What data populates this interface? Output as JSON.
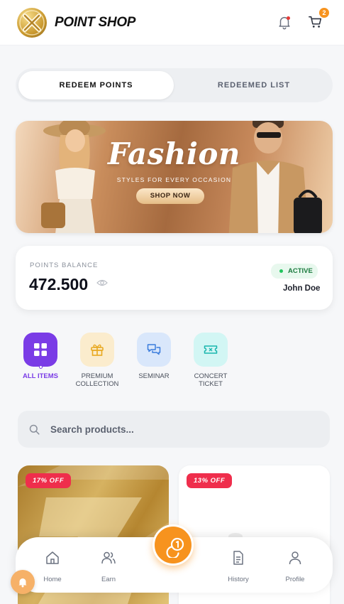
{
  "header": {
    "brand": "POINT SHOP",
    "cart_count": "2"
  },
  "tabs": [
    {
      "label": "REDEEM POINTS",
      "active": true
    },
    {
      "label": "REDEEMED LIST",
      "active": false
    }
  ],
  "banner": {
    "title": "Fashion",
    "subtitle": "STYLES FOR EVERY OCCASION",
    "cta": "SHOP NOW"
  },
  "balance": {
    "label": "POINTS BALANCE",
    "value": "472.500",
    "status": "ACTIVE",
    "user_name": "John Doe"
  },
  "categories": [
    {
      "label": "ALL ITEMS",
      "icon": "grid-icon",
      "active": true
    },
    {
      "label": "PREMIUM COLLECTION",
      "icon": "gift-icon",
      "active": false
    },
    {
      "label": "SEMINAR",
      "icon": "chat-icon",
      "active": false
    },
    {
      "label": "CONCERT TICKET",
      "icon": "ticket-icon",
      "active": false
    }
  ],
  "search": {
    "placeholder": "Search products..."
  },
  "products": [
    {
      "discount": "17% OFF"
    },
    {
      "discount": "13% OFF"
    }
  ],
  "bottom_nav": [
    {
      "label": "Home",
      "icon": "home-icon"
    },
    {
      "label": "Earn",
      "icon": "users-icon"
    },
    {
      "label": "History",
      "icon": "document-icon"
    },
    {
      "label": "Profile",
      "icon": "user-icon"
    }
  ],
  "colors": {
    "accent_purple": "#7a3ce6",
    "accent_orange": "#f7931e",
    "discount_red": "#ef2e4c",
    "active_green": "#22c55e"
  }
}
